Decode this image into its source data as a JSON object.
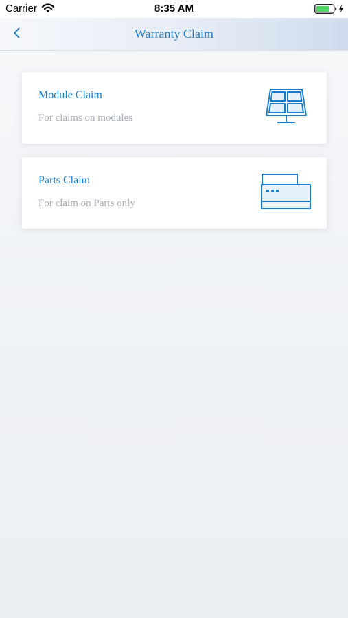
{
  "status_bar": {
    "carrier": "Carrier",
    "time": "8:35 AM",
    "wifi_icon": "wifi-icon",
    "battery_icon": "battery-charging-icon"
  },
  "nav": {
    "title": "Warranty Claim",
    "back_icon": "chevron-left-icon"
  },
  "colors": {
    "accent": "#1a7bc8",
    "subtitle": "#a6abb3",
    "battery_fill": "#4cd964"
  },
  "claims": [
    {
      "title": "Module Claim",
      "subtitle": "For claims on modules",
      "icon": "solar-panel-icon"
    },
    {
      "title": "Parts Claim",
      "subtitle": "For claim on Parts only",
      "icon": "device-box-icon"
    }
  ]
}
